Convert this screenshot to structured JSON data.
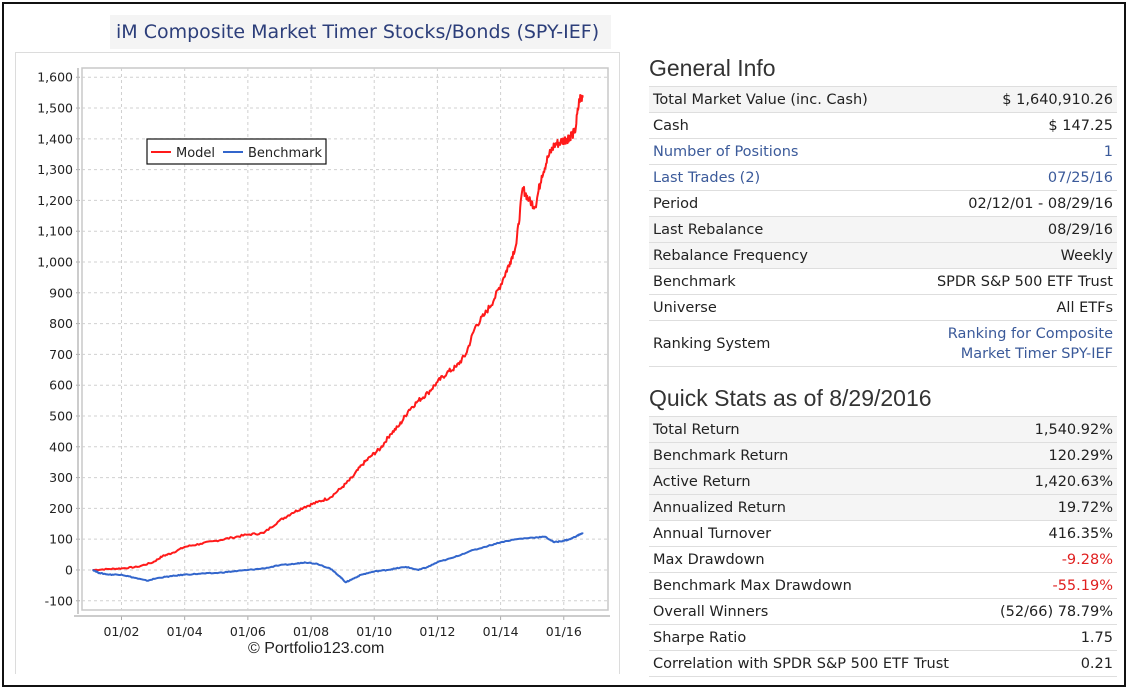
{
  "chart_title": "iM Composite Market Timer Stocks/Bonds (SPY-IEF)",
  "copyright": "© Portfolio123.com",
  "colors": {
    "model": "#ff1a1a",
    "benchmark": "#3366cc",
    "link": "#3b5a9a",
    "negative": "#e02020"
  },
  "chart_data": {
    "type": "line",
    "title": "iM Composite Market Timer Stocks/Bonds (SPY-IEF)",
    "xlabel": "",
    "ylabel": "",
    "xlim": [
      2000.75,
      2017.4
    ],
    "ylim": [
      -130,
      1630
    ],
    "x_ticks": [
      {
        "x": 2002,
        "label": "01/02"
      },
      {
        "x": 2004,
        "label": "01/04"
      },
      {
        "x": 2006,
        "label": "01/06"
      },
      {
        "x": 2008,
        "label": "01/08"
      },
      {
        "x": 2010,
        "label": "01/10"
      },
      {
        "x": 2012,
        "label": "01/12"
      },
      {
        "x": 2014,
        "label": "01/14"
      },
      {
        "x": 2016,
        "label": "01/16"
      }
    ],
    "y_ticks": [
      {
        "y": 1600,
        "label": "1,600"
      },
      {
        "y": 1500,
        "label": "1,500"
      },
      {
        "y": 1400,
        "label": "1,400"
      },
      {
        "y": 1300,
        "label": "1,300"
      },
      {
        "y": 1200,
        "label": "1,200"
      },
      {
        "y": 1100,
        "label": "1,100"
      },
      {
        "y": 1000,
        "label": "1,000"
      },
      {
        "y": 900,
        "label": "900"
      },
      {
        "y": 800,
        "label": "800"
      },
      {
        "y": 700,
        "label": "700"
      },
      {
        "y": 600,
        "label": "600"
      },
      {
        "y": 500,
        "label": "500"
      },
      {
        "y": 400,
        "label": "400"
      },
      {
        "y": 300,
        "label": "300"
      },
      {
        "y": 200,
        "label": "200"
      },
      {
        "y": 100,
        "label": "100"
      },
      {
        "y": 0,
        "label": "0"
      },
      {
        "y": -100,
        "label": "-100"
      }
    ],
    "grid": true,
    "legend": {
      "placement": "top-left",
      "entries": [
        "Model",
        "Benchmark"
      ]
    },
    "series": [
      {
        "name": "Model",
        "x": [
          2001.1,
          2001.6,
          2002.0,
          2002.5,
          2003.0,
          2003.3,
          2003.6,
          2004.0,
          2004.5,
          2005.0,
          2005.5,
          2006.0,
          2006.5,
          2007.0,
          2007.4,
          2007.8,
          2008.2,
          2008.6,
          2009.0,
          2009.3,
          2009.6,
          2009.9,
          2010.2,
          2010.5,
          2010.8,
          2011.1,
          2011.4,
          2011.7,
          2012.0,
          2012.3,
          2012.6,
          2012.9,
          2013.2,
          2013.5,
          2013.8,
          2014.1,
          2014.3,
          2014.5,
          2014.7,
          2014.9,
          2015.1,
          2015.3,
          2015.5,
          2015.7,
          2015.9,
          2016.1,
          2016.2,
          2016.35,
          2016.5,
          2016.6
        ],
        "values": [
          0,
          3,
          5,
          10,
          25,
          45,
          55,
          75,
          85,
          95,
          105,
          115,
          120,
          160,
          185,
          205,
          220,
          235,
          270,
          300,
          340,
          370,
          395,
          440,
          470,
          520,
          550,
          575,
          610,
          640,
          660,
          700,
          790,
          830,
          880,
          950,
          1000,
          1060,
          1240,
          1200,
          1180,
          1280,
          1340,
          1380,
          1390,
          1400,
          1410,
          1420,
          1530,
          1540
        ]
      },
      {
        "name": "Benchmark",
        "x": [
          2001.1,
          2001.3,
          2001.6,
          2002.0,
          2002.4,
          2002.8,
          2003.2,
          2003.6,
          2004.0,
          2004.5,
          2005.0,
          2005.5,
          2006.0,
          2006.5,
          2007.0,
          2007.5,
          2007.8,
          2008.2,
          2008.6,
          2008.9,
          2009.1,
          2009.3,
          2009.6,
          2010.0,
          2010.4,
          2010.7,
          2011.0,
          2011.4,
          2011.7,
          2012.0,
          2012.5,
          2013.0,
          2013.5,
          2014.0,
          2014.5,
          2015.0,
          2015.4,
          2015.7,
          2016.0,
          2016.2,
          2016.4,
          2016.6
        ],
        "values": [
          0,
          -10,
          -15,
          -15,
          -25,
          -35,
          -25,
          -20,
          -15,
          -12,
          -10,
          -5,
          0,
          5,
          15,
          20,
          25,
          20,
          5,
          -20,
          -40,
          -30,
          -15,
          -5,
          0,
          5,
          10,
          0,
          10,
          25,
          40,
          60,
          75,
          90,
          100,
          105,
          108,
          90,
          95,
          100,
          110,
          120
        ]
      }
    ]
  },
  "general_info": {
    "heading": "General Info",
    "rows": [
      {
        "label": "Total Market Value (inc. Cash)",
        "value": "$ 1,640,910.26",
        "link": false
      },
      {
        "label": "Cash",
        "value": "$ 147.25",
        "link": false
      },
      {
        "label": "Number of Positions",
        "value": "1",
        "link": true
      },
      {
        "label": "Last Trades (2)",
        "value": "07/25/16",
        "link": true
      },
      {
        "label": "Period",
        "value": "02/12/01 - 08/29/16",
        "link": false
      },
      {
        "label": "Last Rebalance",
        "value": "08/29/16",
        "link": false
      },
      {
        "label": "Rebalance Frequency",
        "value": "Weekly",
        "link": false
      },
      {
        "label": "Benchmark",
        "value": "SPDR S&P 500 ETF Trust",
        "link": false
      },
      {
        "label": "Universe",
        "value": "All ETFs",
        "link": false
      },
      {
        "label": "Ranking System",
        "value_line1": "Ranking for Composite",
        "value_line2": "Market Timer SPY-IEF",
        "link": true
      }
    ]
  },
  "quick_stats": {
    "heading": "Quick Stats as of 8/29/2016",
    "rows": [
      {
        "label": "Total Return",
        "value": "1,540.92%"
      },
      {
        "label": "Benchmark Return",
        "value": "120.29%"
      },
      {
        "label": "Active Return",
        "value": "1,420.63%"
      },
      {
        "label": "Annualized Return",
        "value": "19.72%"
      },
      {
        "label": "Annual Turnover",
        "value": "416.35%"
      },
      {
        "label": "Max Drawdown",
        "value": "-9.28%"
      },
      {
        "label": "Benchmark Max Drawdown",
        "value": "-55.19%"
      },
      {
        "label": "Overall Winners",
        "value": "(52/66) 78.79%"
      },
      {
        "label": "Sharpe Ratio",
        "value": "1.75"
      },
      {
        "label": "Correlation with SPDR S&P 500 ETF Trust",
        "value": "0.21"
      }
    ]
  }
}
